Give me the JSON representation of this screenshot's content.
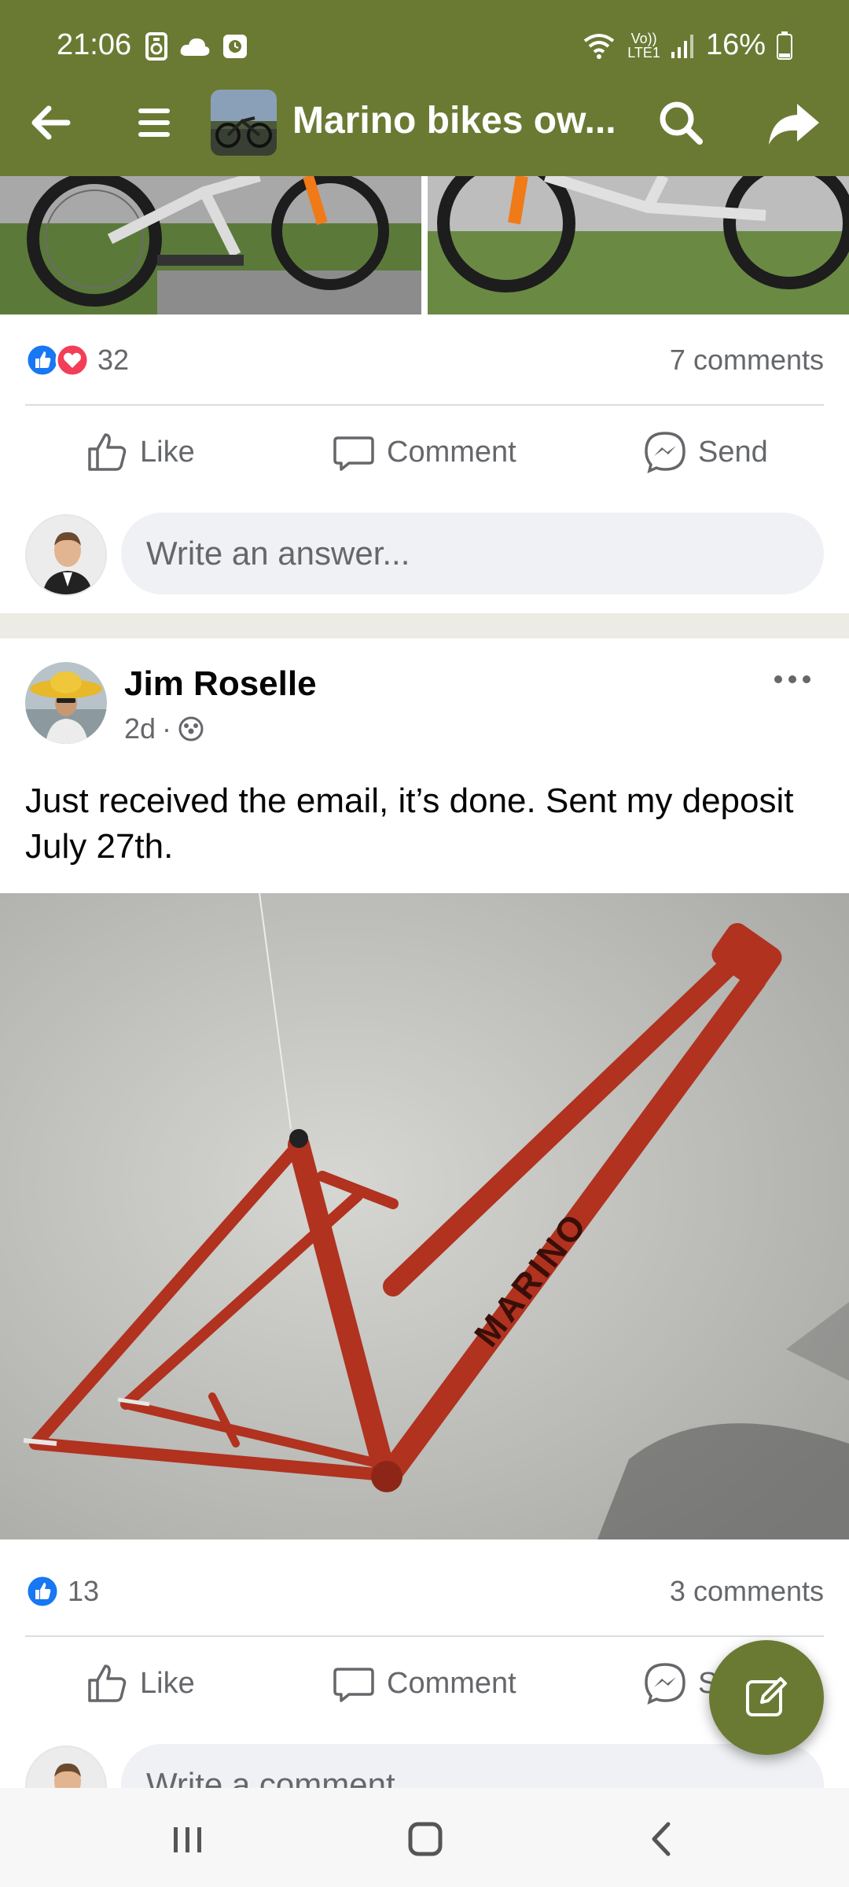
{
  "status_bar": {
    "time": "21:06",
    "battery": "16%",
    "network_label": "LTE1",
    "volte_label": "Vo))"
  },
  "toolbar": {
    "title": "Marino bikes ow...",
    "icons": [
      "back-arrow-icon",
      "menu-icon",
      "group-avatar",
      "search-icon",
      "share-icon"
    ]
  },
  "post1": {
    "reaction_count": "32",
    "comments": "7 comments",
    "actions": {
      "like": "Like",
      "comment": "Comment",
      "send": "Send"
    },
    "input_placeholder": "Write an answer..."
  },
  "post2": {
    "author": "Jim Roselle",
    "time": "2d",
    "text": "Just received the email, it’s done. Sent my deposit July 27th.",
    "image_label": "MARINO",
    "reaction_count": "13",
    "comments": "3 comments",
    "actions": {
      "like": "Like",
      "comment": "Comment",
      "send": "Send"
    },
    "input_placeholder": "Write a comment..."
  },
  "colors": {
    "brand": "#6b7a33",
    "like_blue": "#1877f2",
    "love_red": "#f33e58",
    "frame_red": "#b0321f"
  }
}
